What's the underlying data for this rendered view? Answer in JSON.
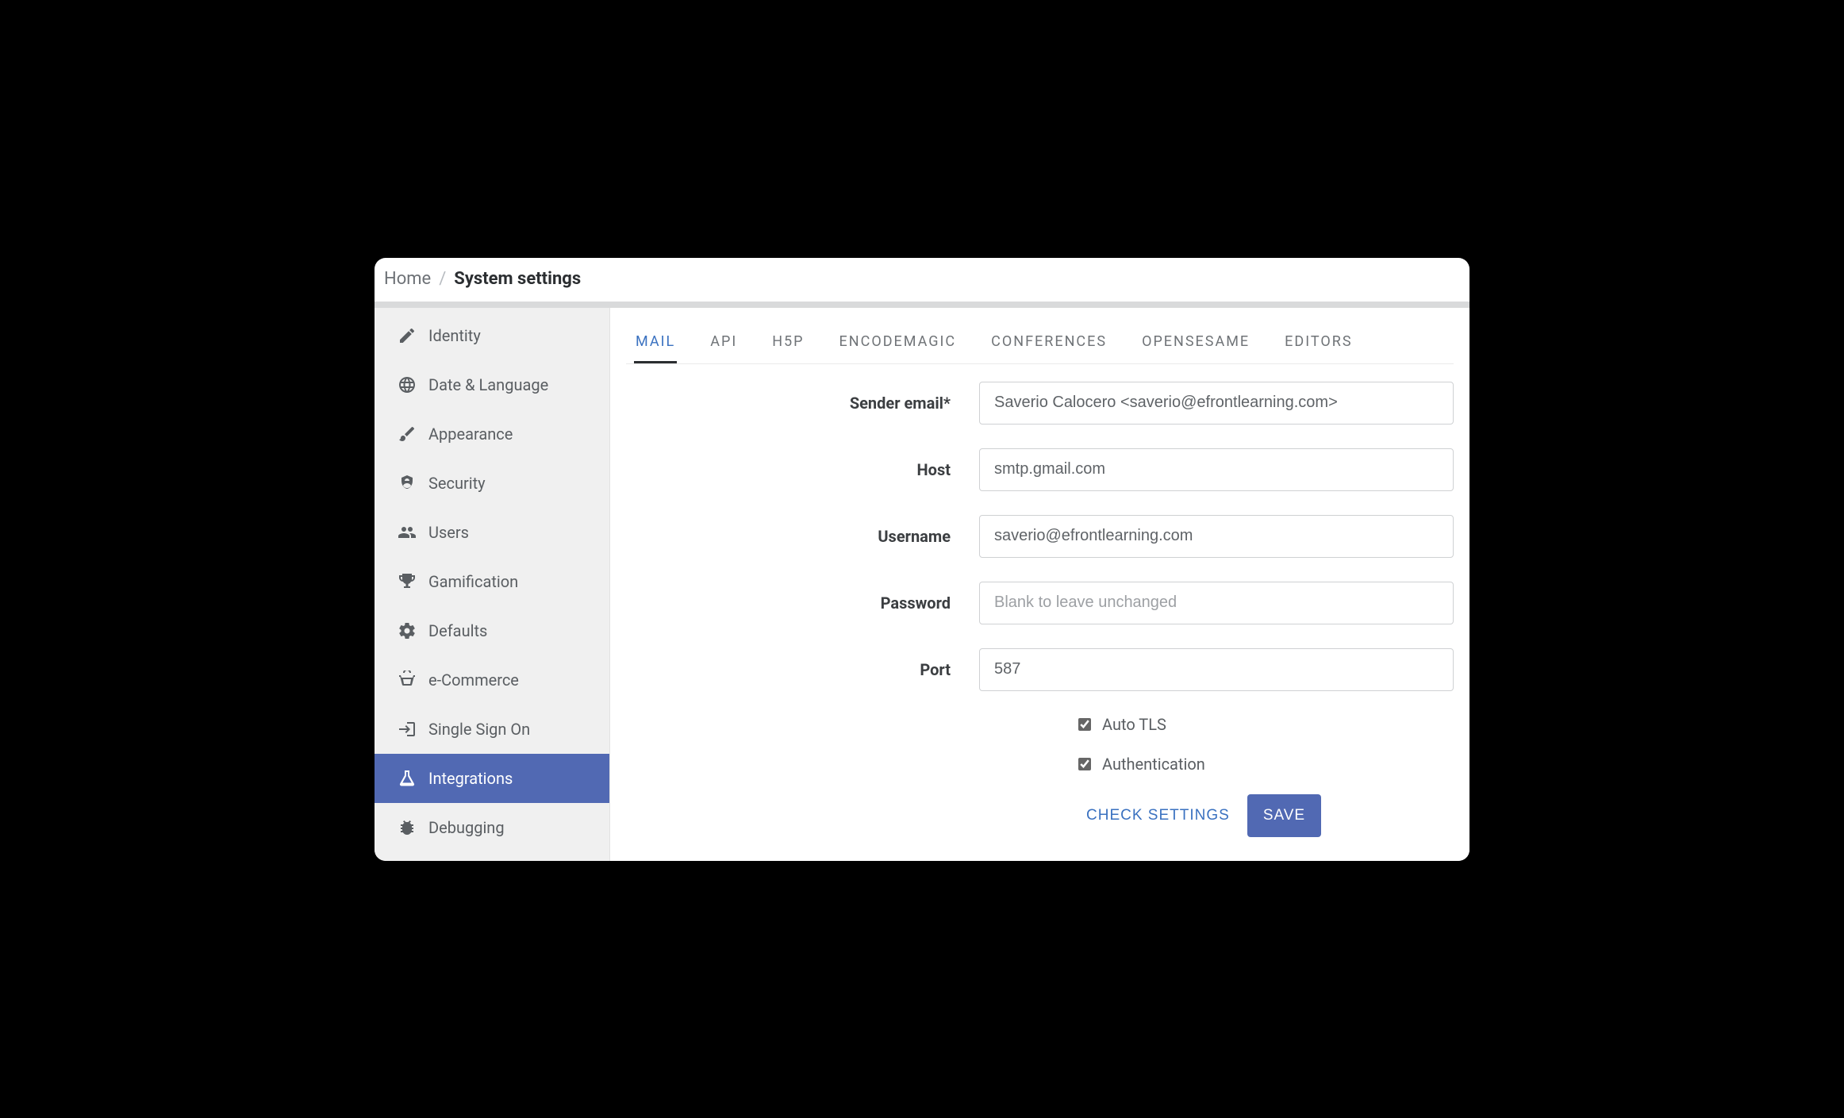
{
  "breadcrumb": {
    "home": "Home",
    "title": "System settings"
  },
  "sidebar": {
    "items": [
      {
        "id": "identity",
        "label": "Identity"
      },
      {
        "id": "datelang",
        "label": "Date & Language"
      },
      {
        "id": "appearance",
        "label": "Appearance"
      },
      {
        "id": "security",
        "label": "Security"
      },
      {
        "id": "users",
        "label": "Users"
      },
      {
        "id": "gamification",
        "label": "Gamification"
      },
      {
        "id": "defaults",
        "label": "Defaults"
      },
      {
        "id": "ecommerce",
        "label": "e-Commerce"
      },
      {
        "id": "sso",
        "label": "Single Sign On"
      },
      {
        "id": "integrations",
        "label": "Integrations"
      },
      {
        "id": "debugging",
        "label": "Debugging"
      }
    ]
  },
  "tabs": [
    {
      "id": "mail",
      "label": "MAIL"
    },
    {
      "id": "api",
      "label": "API"
    },
    {
      "id": "h5p",
      "label": "H5P"
    },
    {
      "id": "encodemagic",
      "label": "ENCODEMAGIC"
    },
    {
      "id": "conferences",
      "label": "CONFERENCES"
    },
    {
      "id": "opensesame",
      "label": "OPENSESAME"
    },
    {
      "id": "editors",
      "label": "EDITORS"
    }
  ],
  "form": {
    "sender_email": {
      "label": "Sender email*",
      "value": "Saverio Calocero <saverio@efrontlearning.com>"
    },
    "host": {
      "label": "Host",
      "value": "smtp.gmail.com"
    },
    "username": {
      "label": "Username",
      "value": "saverio@efrontlearning.com"
    },
    "password": {
      "label": "Password",
      "value": "",
      "placeholder": "Blank to leave unchanged"
    },
    "port": {
      "label": "Port",
      "value": "587"
    },
    "auto_tls": {
      "label": "Auto TLS",
      "checked": true
    },
    "authentication": {
      "label": "Authentication",
      "checked": true
    }
  },
  "actions": {
    "check": "CHECK SETTINGS",
    "save": "SAVE"
  }
}
